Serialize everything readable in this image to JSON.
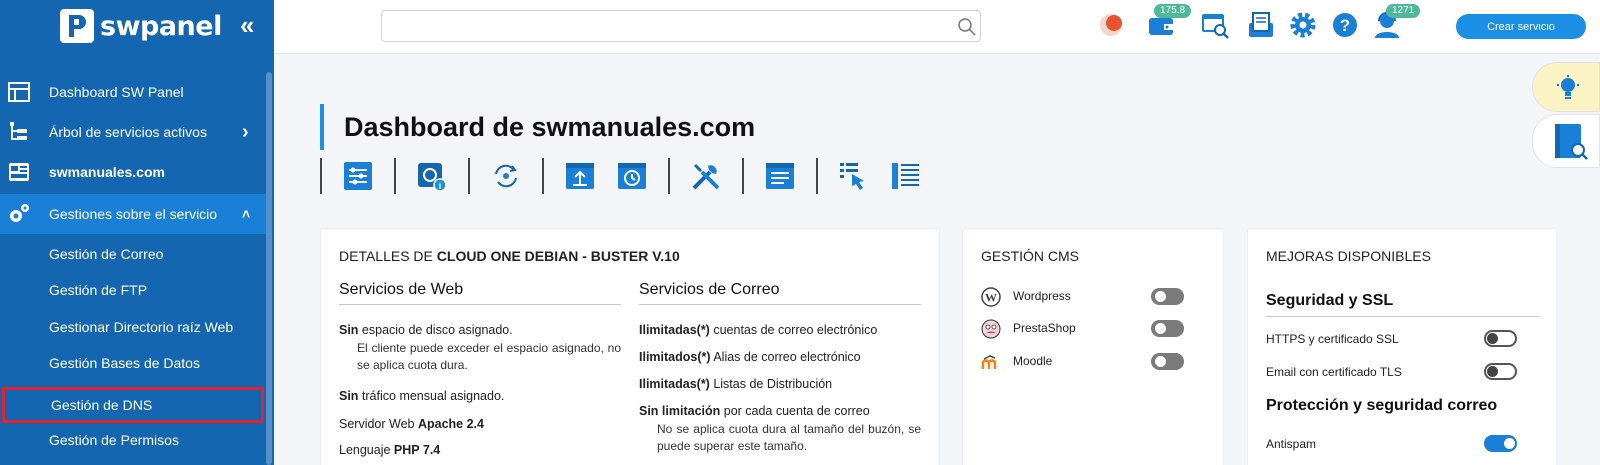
{
  "sidebar": {
    "logo_text": "swpanel",
    "collapse_glyph": "«",
    "items": [
      {
        "label": "Dashboard SW Panel",
        "icon": "table-icon"
      },
      {
        "label": "Árbol de servicios activos",
        "icon": "tree-icon",
        "arrow": "›"
      },
      {
        "label": "swmanuales.com",
        "icon": "server-icon"
      },
      {
        "label": "Gestiones sobre el servicio",
        "icon": "gears-icon",
        "arrow": "˄"
      }
    ],
    "subitems": [
      {
        "label": "Gestión de Correo"
      },
      {
        "label": "Gestión de FTP"
      },
      {
        "label": "Gestionar Directorio raíz Web"
      },
      {
        "label": "Gestión Bases de Datos"
      },
      {
        "label": "Gestión de DNS"
      },
      {
        "label": "Gestión de Permisos"
      }
    ]
  },
  "topbar": {
    "search_placeholder": "",
    "wallet_badge": "175.8",
    "support_badge": "1271",
    "create_button": "Crear servicio"
  },
  "main": {
    "title": "Dashboard de swmanuales.com",
    "details": {
      "title_prefix": "DETALLES DE ",
      "title_bold": "CLOUD ONE DEBIAN - BUSTER V.10",
      "web": {
        "heading": "Servicios de Web",
        "disk_bold": "Sin",
        "disk_text": " espacio de disco asignado.",
        "disk_note": "El cliente puede exceder el espacio asignado, no se aplica cuota dura.",
        "traffic_bold": "Sin",
        "traffic_text": " tráfico mensual asignado.",
        "server_text": "Servidor Web ",
        "server_bold": "Apache 2.4",
        "lang_text": "Lenguaje ",
        "lang_bold": "PHP 7.4"
      },
      "mail": {
        "heading": "Servicios de Correo",
        "accounts_bold": "Ilimitadas(*)",
        "accounts_text": " cuentas de correo electrónico",
        "alias_bold": "Ilimitados(*)",
        "alias_text": " Alias de correo electrónico",
        "lists_bold": "Ilimitadas(*)",
        "lists_text": " Listas de Distribución",
        "limit_bold": "Sin limitación",
        "limit_text": " por cada cuenta de correo",
        "limit_note": "No se aplica cuota dura al tamaño del buzón, se puede superar este tamaño."
      }
    },
    "cms": {
      "title": "GESTIÓN CMS",
      "items": [
        {
          "label": "Wordpress",
          "icon": "wordpress-icon",
          "enabled": false
        },
        {
          "label": "PrestaShop",
          "icon": "prestashop-icon",
          "enabled": false
        },
        {
          "label": "Moodle",
          "icon": "moodle-icon",
          "enabled": false
        }
      ]
    },
    "upgrades": {
      "title": "MEJORAS DISPONIBLES",
      "security_heading": "Seguridad y SSL",
      "https_label": "HTTPS y certificado SSL",
      "tls_label": "Email con certificado TLS",
      "mail_heading": "Protección y seguridad correo",
      "antispam_label": "Antispam",
      "https_enabled": false,
      "tls_enabled": false,
      "antispam_enabled": true
    }
  },
  "colors": {
    "sidebar": "#1466b0",
    "sidebar_active": "#1a7fd6",
    "accent": "#1a8fe3",
    "badge": "#4fb89b",
    "highlight_border": "#e52330"
  }
}
